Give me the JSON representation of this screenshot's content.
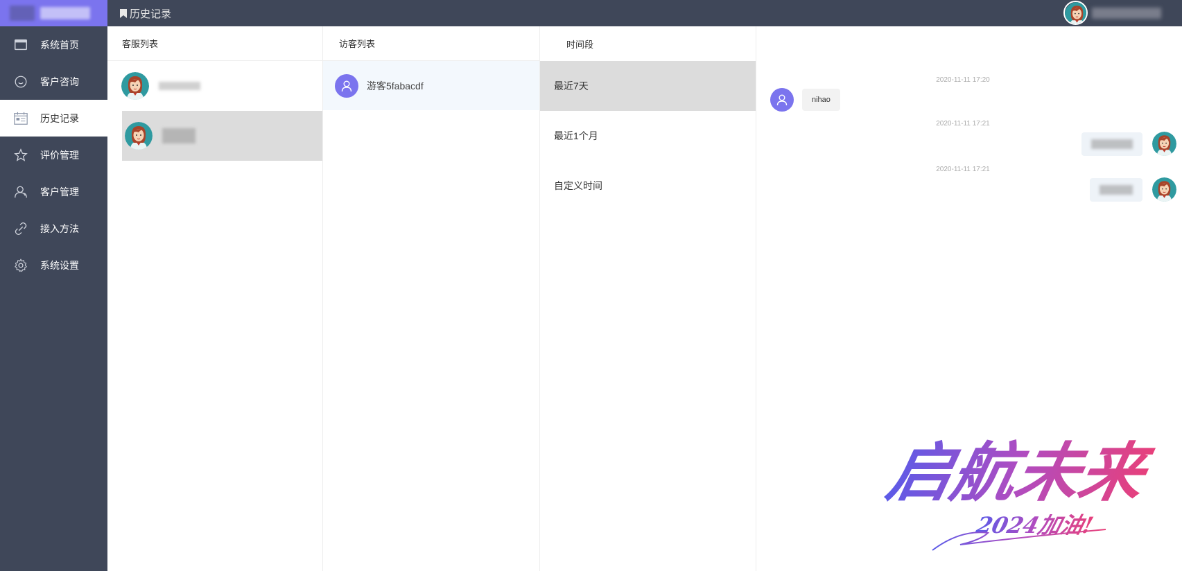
{
  "topbar": {
    "title": "历史记录"
  },
  "sidebar": {
    "items": [
      {
        "label": "系统首页",
        "icon": "window-icon"
      },
      {
        "label": "客户咨询",
        "icon": "smile-icon"
      },
      {
        "label": "历史记录",
        "icon": "calendar-icon",
        "active": true
      },
      {
        "label": "评价管理",
        "icon": "star-icon"
      },
      {
        "label": "客户管理",
        "icon": "user-icon"
      },
      {
        "label": "接入方法",
        "icon": "link-icon"
      },
      {
        "label": "系统设置",
        "icon": "gear-icon"
      }
    ]
  },
  "agents": {
    "header": "客服列表"
  },
  "visitors": {
    "header": "访客列表",
    "items": [
      {
        "name": "游客5fabacdf"
      }
    ]
  },
  "periods": {
    "header": "时间段",
    "items": [
      "最近7天",
      "最近1个月",
      "自定义时间"
    ],
    "selected": "最近7天"
  },
  "chat": {
    "messages": [
      {
        "time": "2020-11-11 17:20",
        "side": "left",
        "text": "nihao"
      },
      {
        "time": "2020-11-11 17:21",
        "side": "right"
      },
      {
        "time": "2020-11-11 17:21",
        "side": "right"
      }
    ]
  },
  "watermark": {
    "title": "启航未来",
    "subtitle": "2024加油!"
  },
  "colors": {
    "sidebar": "#3f4759",
    "accent": "#7b74ee",
    "selected": "#dcdcdc"
  }
}
